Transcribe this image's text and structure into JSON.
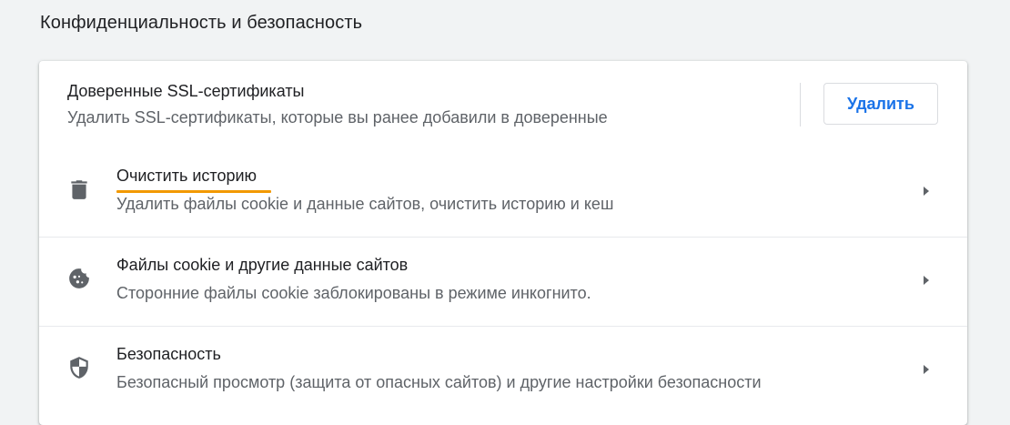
{
  "section": {
    "title": "Конфиденциальность и безопасность"
  },
  "ssl": {
    "title": "Доверенные SSL-сертификаты",
    "subtitle": "Удалить SSL-сертификаты, которые вы ранее добавили в доверенные",
    "button_label": "Удалить"
  },
  "items": [
    {
      "title": "Очистить историю",
      "subtitle": "Удалить файлы cookie и данные сайтов, очистить историю и кеш",
      "icon": "trash-icon"
    },
    {
      "title": "Файлы cookie и другие данные сайтов",
      "subtitle": "Сторонние файлы cookie заблокированы в режиме инкогнито.",
      "icon": "cookie-icon"
    },
    {
      "title": "Безопасность",
      "subtitle": "Безопасный просмотр (защита от опасных сайтов) и другие настройки безопасности",
      "icon": "shield-icon"
    }
  ],
  "colors": {
    "accent": "#1a73e8",
    "highlight": "#f29900",
    "background": "#f1f3f4",
    "icon": "#5f6368"
  }
}
